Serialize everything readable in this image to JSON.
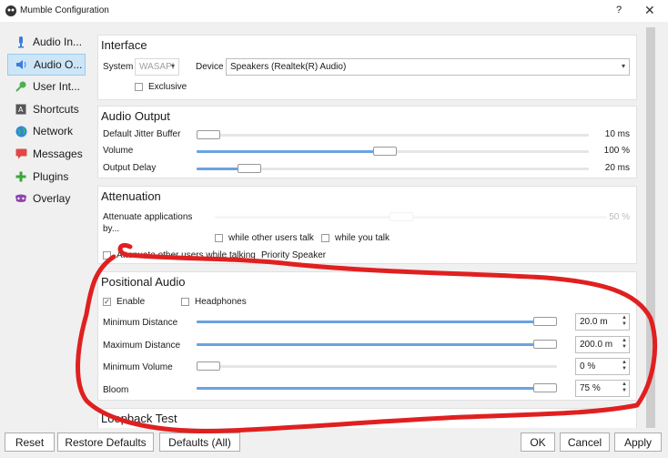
{
  "window": {
    "title": "Mumble Configuration",
    "help_label": "?",
    "close_label": "✕"
  },
  "sidebar": {
    "items": [
      {
        "label": "Audio In...",
        "icon": "microphone-icon"
      },
      {
        "label": "Audio O...",
        "icon": "speaker-icon"
      },
      {
        "label": "User Int...",
        "icon": "user-interface-icon"
      },
      {
        "label": "Shortcuts",
        "icon": "keyboard-icon"
      },
      {
        "label": "Network",
        "icon": "globe-icon"
      },
      {
        "label": "Messages",
        "icon": "message-icon"
      },
      {
        "label": "Plugins",
        "icon": "plugin-icon"
      },
      {
        "label": "Overlay",
        "icon": "overlay-icon"
      }
    ]
  },
  "interface": {
    "title": "Interface",
    "system_label": "System",
    "system_value": "WASAPI",
    "device_label": "Device",
    "device_value": "Speakers (Realtek(R) Audio)",
    "exclusive_label": "Exclusive"
  },
  "audio_output": {
    "title": "Audio Output",
    "rows": [
      {
        "label": "Default Jitter Buffer",
        "value": "10 ms",
        "level": 0
      },
      {
        "label": "Volume",
        "value": "100 %",
        "level": 0.48
      },
      {
        "label": "Output Delay",
        "value": "20 ms",
        "level": 0.11
      }
    ]
  },
  "attenuation": {
    "title": "Attenuation",
    "label": "Attenuate applications by...",
    "value": "50 %",
    "while_others_label": "while other users talk",
    "while_you_label": "while you talk",
    "other_users_label": "Attenuate other users while talking",
    "priority_label": "Priority Speaker"
  },
  "positional": {
    "title": "Positional Audio",
    "enable_label": "Enable",
    "headphones_label": "Headphones",
    "rows": [
      {
        "label": "Minimum Distance",
        "value": "20.0 m",
        "level": 1.0
      },
      {
        "label": "Maximum Distance",
        "value": "200.0 m",
        "level": 1.0
      },
      {
        "label": "Minimum Volume",
        "value": "0 %",
        "level": 0
      },
      {
        "label": "Bloom",
        "value": "75 %",
        "level": 1.0
      }
    ]
  },
  "loopback": {
    "title": "Loopback Test"
  },
  "buttons": {
    "reset": "Reset",
    "restore": "Restore Defaults",
    "defaults_all": "Defaults (All)",
    "ok": "OK",
    "cancel": "Cancel",
    "apply": "Apply"
  },
  "colors": {
    "accent": "#6aa3e0",
    "annotation": "#e02020",
    "selected": "#cde6f7"
  }
}
